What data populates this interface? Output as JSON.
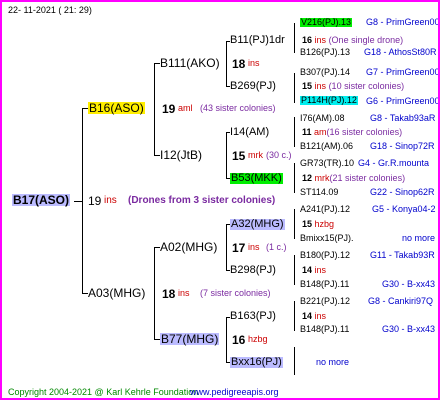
{
  "header": {
    "date": "22- 11-2021 ( 21: 29)"
  },
  "footer": {
    "copyright": "Copyright 2004-2021 @ Karl Kehrle Foundation",
    "url": "www.pedigreeapis.org"
  },
  "colors": {
    "frame": "#ff00ff",
    "green_hl": "#00ee00",
    "cyan_hl": "#00eeee",
    "yellow_hl": "#ffee00",
    "blue_hl": "#bbbbff",
    "pink_hl": "#ffaadd",
    "ins_red": "#cc0000",
    "note_purple": "#7a2aa0",
    "link_blue": "#0000cc"
  },
  "root": {
    "name": "B17(ASO)",
    "gen": "19",
    "ins": "ins",
    "note": "(Drones from 3 sister colonies)"
  },
  "sire": {
    "name": "B16(ASO)",
    "gen": "19",
    "ins": "aml",
    "note": "(43 sister colonies)"
  },
  "dam": {
    "name": "A03(MHG)",
    "gen": "18",
    "ins": "ins",
    "note": "(7 sister colonies)"
  },
  "s_s": {
    "name": "B111(AKO)",
    "gen": "18",
    "ins": "ins"
  },
  "s_d": {
    "name": "I12(JtB)",
    "gen": "15",
    "ins": "mrk",
    "note": "(30 c.)"
  },
  "d_s": {
    "name": "A02(MHG)",
    "gen": "17",
    "ins": "ins",
    "note": "(1 c.)"
  },
  "d_d": {
    "name": "B77(MHG)",
    "gen": "16",
    "ins": "hzbg"
  },
  "g3": [
    {
      "name": "B11(PJ)1dr",
      "gen": "16",
      "ins": "ins",
      "note": "(One single drone)"
    },
    {
      "name": "B269(PJ)",
      "gen": "15",
      "ins": "ins",
      "note": "(10 sister colonies)"
    },
    {
      "name": "I14(AM)",
      "gen": "11",
      "ins": "am",
      "note": "(16 sister colonies)"
    },
    {
      "name": "B53(MKK)",
      "gen": "12",
      "ins": "mrk",
      "note": "(21 sister colonies)"
    },
    {
      "name": "A32(MHG)",
      "gen": "15",
      "ins": "hzbg",
      "note": ""
    },
    {
      "name": "B298(PJ)",
      "gen": "14",
      "ins": "ins",
      "note": ""
    },
    {
      "name": "B163(PJ)",
      "gen": "14",
      "ins": "ins",
      "note": ""
    },
    {
      "name": "Bxx16(PJ)",
      "gen": "",
      "ins": "",
      "note": "no more"
    }
  ],
  "g4": [
    {
      "name": "V216(PJ).13",
      "owner": "G8 - PrimGreen00"
    },
    {
      "name": "B126(PJ).13",
      "owner": "G18 - AthosSt80R"
    },
    {
      "name": "B307(PJ).14",
      "owner": "G7 - PrimGreen00"
    },
    {
      "name": "P114H(PJ).12",
      "owner": "G6 - PrimGreen00"
    },
    {
      "name": "I76(AM).08",
      "owner": "G8 - Takab93aR"
    },
    {
      "name": "B121(AM).06",
      "owner": "G18 - Sinop72R"
    },
    {
      "name": "GR73(TR).10",
      "owner": "G4 - Gr.R.mounta"
    },
    {
      "name": "ST114.09",
      "owner": "G22 - Sinop62R"
    },
    {
      "name": "A241(PJ).12",
      "owner": "G5 - Konya04-2"
    },
    {
      "name": "Bmixx15(PJ).",
      "owner": "no more"
    },
    {
      "name": "B180(PJ).12",
      "owner": "G11 - Takab93R"
    },
    {
      "name": "B148(PJ).11",
      "owner": "G30 - B-xx43"
    },
    {
      "name": "B221(PJ).12",
      "owner": "G8 - Cankiri97Q"
    },
    {
      "name": "B148(PJ).11",
      "owner": "G30 - B-xx43"
    }
  ]
}
